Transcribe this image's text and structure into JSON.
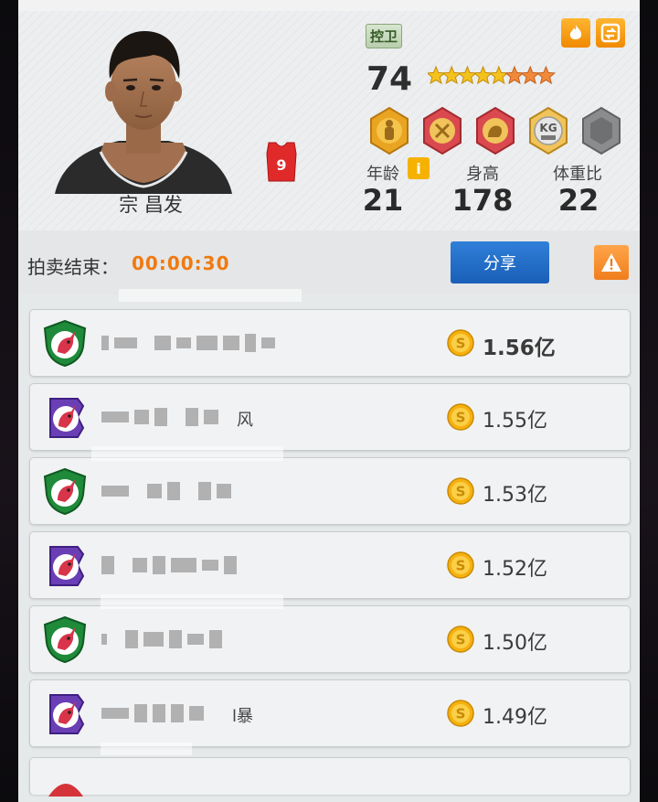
{
  "player": {
    "name": "宗 昌发",
    "position": "控卫",
    "rating": "74",
    "jersey_number": "9",
    "stars_total": 8,
    "stars_gold": 5,
    "stats": [
      {
        "label": "年龄",
        "value": "21"
      },
      {
        "label": "身高",
        "value": "178"
      },
      {
        "label": "体重比",
        "value": "22"
      }
    ],
    "skill_icons": [
      "defender-skill-icon",
      "blocked-skill-icon",
      "muscle-skill-icon",
      "kg-skill-icon",
      "locked-skill-icon"
    ]
  },
  "auction": {
    "label": "拍卖结束：",
    "time": "00:00:30",
    "share_label": "分享"
  },
  "bids": [
    {
      "team_logo": "unicorn-green-shield",
      "name_suffix": "",
      "price": "1.56亿"
    },
    {
      "team_logo": "unicorn-purple-badge",
      "name_suffix": "风",
      "price": "1.55亿"
    },
    {
      "team_logo": "unicorn-green-shield",
      "name_suffix": "",
      "price": "1.53亿"
    },
    {
      "team_logo": "unicorn-purple-badge",
      "name_suffix": "",
      "price": "1.52亿"
    },
    {
      "team_logo": "unicorn-green-shield",
      "name_suffix": "",
      "price": "1.50亿"
    },
    {
      "team_logo": "unicorn-purple-badge",
      "name_suffix": "l暴",
      "price": "1.49亿"
    }
  ],
  "colors": {
    "accent_orange": "#f07a10",
    "share_blue": "#1f6cc6",
    "star_gold": "#f4c21c",
    "star_orange": "#f08a3a"
  }
}
